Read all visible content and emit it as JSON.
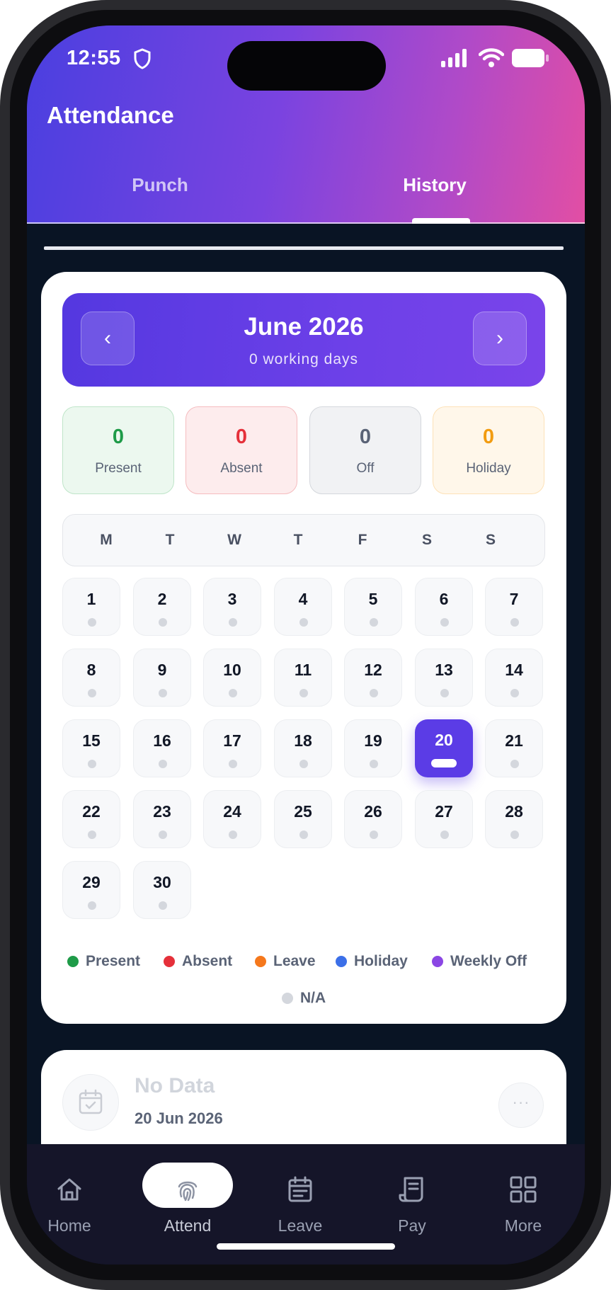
{
  "status_bar": {
    "time": "12:55"
  },
  "header": {
    "title": "Attendance",
    "tabs": [
      {
        "label": "Punch",
        "active": false
      },
      {
        "label": "History",
        "active": true
      }
    ]
  },
  "calendar": {
    "month_title": "June 2026",
    "subtitle": "0 working days",
    "prev_label": "‹",
    "next_label": "›",
    "stats": {
      "present": {
        "value": "0",
        "label": "Present"
      },
      "absent": {
        "value": "0",
        "label": "Absent"
      },
      "off": {
        "value": "0",
        "label": "Off"
      },
      "holiday": {
        "value": "0",
        "label": "Holiday"
      }
    },
    "weekdays": [
      "M",
      "T",
      "W",
      "T",
      "F",
      "S",
      "S"
    ],
    "days": [
      "1",
      "2",
      "3",
      "4",
      "5",
      "6",
      "7",
      "8",
      "9",
      "10",
      "11",
      "12",
      "13",
      "14",
      "15",
      "16",
      "17",
      "18",
      "19",
      "20",
      "21",
      "22",
      "23",
      "24",
      "25",
      "26",
      "27",
      "28",
      "29",
      "30"
    ],
    "selected_day": "20",
    "legend": [
      {
        "label": "Present",
        "color": "#1e9b48"
      },
      {
        "label": "Absent",
        "color": "#e5303a"
      },
      {
        "label": "Leave",
        "color": "#f5781c"
      },
      {
        "label": "Holiday",
        "color": "#3b6fe8"
      },
      {
        "label": "Weekly Off",
        "color": "#8b46e4"
      },
      {
        "label": "N/A",
        "color": "#d4d7dd"
      }
    ]
  },
  "detail_card": {
    "title": "No Data",
    "date": "20 Jun 2026",
    "more_label": "···"
  },
  "bottom_nav": [
    {
      "label": "Home",
      "icon": "home-icon",
      "active": false
    },
    {
      "label": "Attend",
      "icon": "fingerprint-icon",
      "active": true
    },
    {
      "label": "Leave",
      "icon": "calendar-icon",
      "active": false
    },
    {
      "label": "Pay",
      "icon": "receipt-icon",
      "active": false
    },
    {
      "label": "More",
      "icon": "grid-icon",
      "active": false
    }
  ],
  "colors": {
    "accent": "#5b3ce6",
    "background": "#091424",
    "nav_background": "#151529"
  }
}
